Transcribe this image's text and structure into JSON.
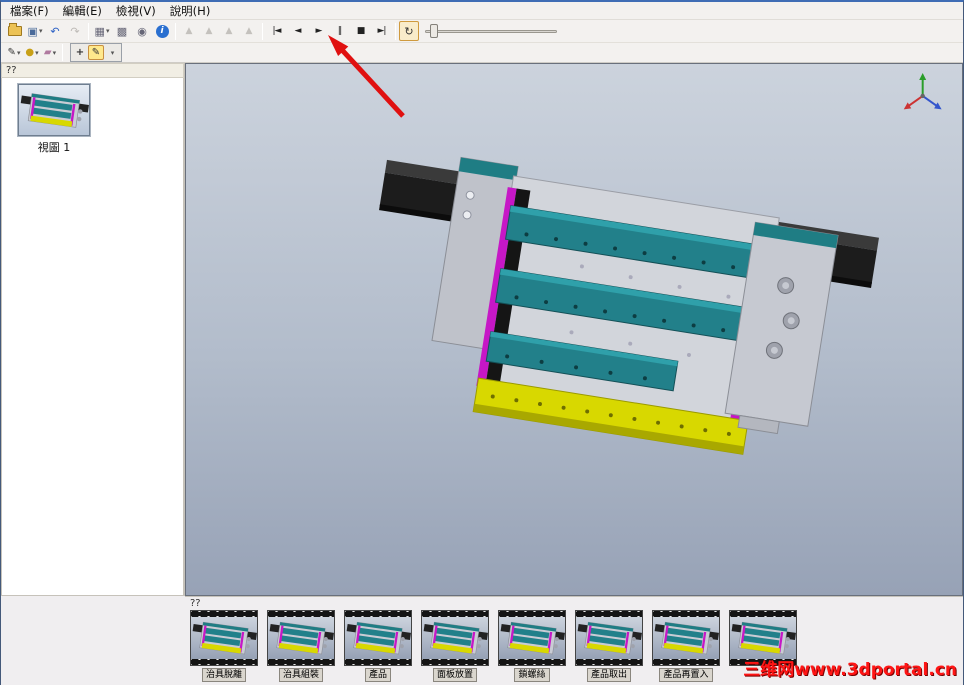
{
  "menu_bar": {
    "items": [
      {
        "label": "檔案(F)"
      },
      {
        "label": "編輯(E)"
      },
      {
        "label": "檢視(V)"
      },
      {
        "label": "說明(H)"
      }
    ]
  },
  "toolbar_top": {
    "export_glyph": "▣",
    "undo_glyph": "↶",
    "redo_glyph": "↷",
    "grid_glyph": "▦",
    "checker_glyph": "▩",
    "camera_glyph": "◉",
    "info_glyph": "i",
    "keyframe_glyph": "▲",
    "caret_glyph": "▾",
    "playback": {
      "first": "|◄",
      "prev": "◄",
      "play": "►",
      "pause": "‖",
      "stop": "■",
      "last": "►|",
      "loop": "↻"
    },
    "slider_position_pct": 4
  },
  "toolbar_draw": {
    "pen_glyph": "✎",
    "shape_glyph": "●",
    "eraser_glyph": "▰",
    "caret_glyph": "▾",
    "move_glyph": "+",
    "pen_active_glyph": "✎",
    "more_glyph": "▾"
  },
  "left_panel": {
    "header": "??",
    "views": [
      {
        "label": "視圖 1"
      }
    ]
  },
  "viewport": {
    "gradient_top": "#ccd3dd",
    "gradient_bottom": "#97a2b6",
    "model_colors": {
      "rail": "#1c1c1c",
      "plate": "#c6c9d1",
      "panel": "#d2d5db",
      "teal": "#22808a",
      "magenta": "#c617c6",
      "yellow": "#d8d800",
      "black_strip": "#151515"
    }
  },
  "bottom_panel": {
    "header": "??",
    "clips": [
      {
        "label": "治具脫離"
      },
      {
        "label": "治具組裝"
      },
      {
        "label": "產品"
      },
      {
        "label": "面板放置"
      },
      {
        "label": "鎖螺絲"
      },
      {
        "label": "產品取出"
      },
      {
        "label": "產品再置入"
      },
      {
        "label": ""
      }
    ]
  },
  "annotation": {
    "arrow_color": "#e01010"
  },
  "watermark": {
    "text": "三维网www.3dportal.cn",
    "color": "#ff1515"
  }
}
